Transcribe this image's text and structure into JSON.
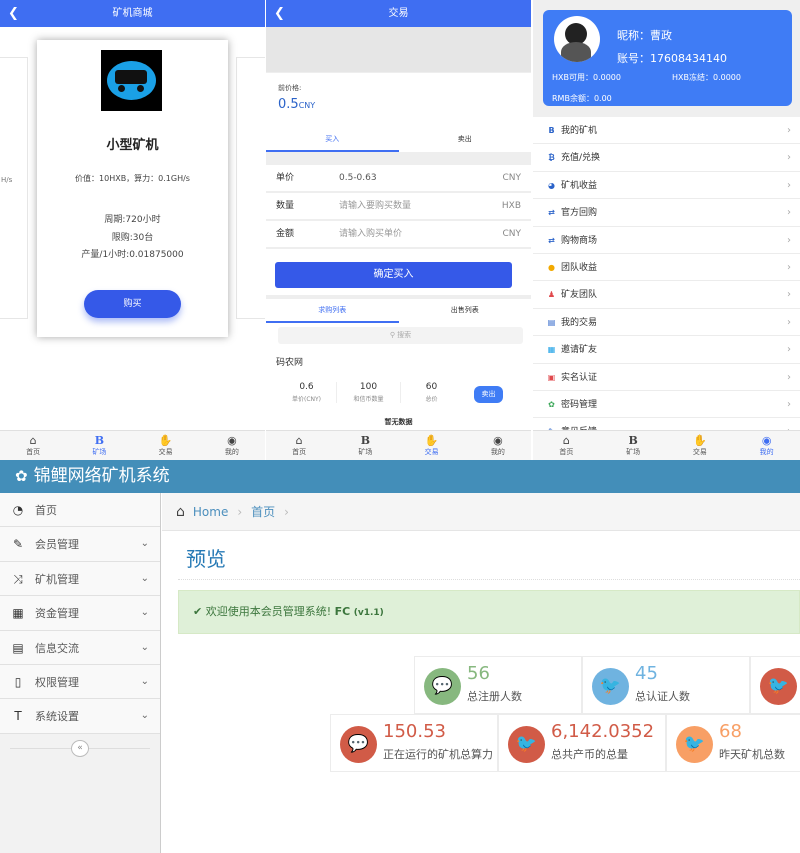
{
  "mining_mall": {
    "header_title": "矿机商城",
    "edge_text": "H/s",
    "product": {
      "name": "小型矿机",
      "price_line": "价值：10HXB，算力：0.1GH/s",
      "period": "周期:720小时",
      "limit": "限购:30台",
      "output": "产量/1小时:0.01875000",
      "buy_label": "购买"
    }
  },
  "trade": {
    "header_title": "交易",
    "prev_price_label": "前价格:",
    "prev_price_value": "0.5",
    "prev_price_unit": "CNY",
    "tabs": [
      "买入",
      "卖出"
    ],
    "form": [
      {
        "label": "单价",
        "value": "0.5-0.63",
        "unit": "CNY"
      },
      {
        "label": "数量",
        "placeholder": "请输入要购买数量",
        "unit": "HXB"
      },
      {
        "label": "金额",
        "placeholder": "请输入购买单价",
        "unit": "CNY"
      }
    ],
    "confirm_label": "确定买入",
    "list_tabs": [
      "求购列表",
      "出售列表"
    ],
    "search_placeholder": "搜索",
    "shop_name": "码农网",
    "order": {
      "unit_price": "0.6",
      "unit_price_label": "单价(CNY)",
      "quantity": "100",
      "quantity_label": "和信币数量",
      "total": "60",
      "total_label": "总价",
      "sell_label": "卖出"
    },
    "no_data": "暂无数据"
  },
  "profile": {
    "nickname": "昵称：曹政",
    "account": "账号：17608434140",
    "hxb_available": "HXB可用：0.0000",
    "hxb_frozen": "HXB冻结：0.0000",
    "rmb_balance": "RMB余额：0.00",
    "menu": [
      {
        "label": "我的矿机",
        "icon": "B",
        "color": "#2b63c9"
      },
      {
        "label": "充值/兑换",
        "icon": "₿",
        "color": "#2b63c9"
      },
      {
        "label": "矿机收益",
        "icon": "◕",
        "color": "#2b63c9"
      },
      {
        "label": "官方回购",
        "icon": "⇄",
        "color": "#2b63c9"
      },
      {
        "label": "购物商场",
        "icon": "⇄",
        "color": "#2b63c9"
      },
      {
        "label": "团队收益",
        "icon": "●",
        "color": "#f2a900"
      },
      {
        "label": "矿友团队",
        "icon": "♟",
        "color": "#e0484c"
      },
      {
        "label": "我的交易",
        "icon": "▤",
        "color": "#2b63c9"
      },
      {
        "label": "邀请矿友",
        "icon": "▦",
        "color": "#1aa0e6"
      },
      {
        "label": "实名认证",
        "icon": "▣",
        "color": "#e0484c"
      },
      {
        "label": "密码管理",
        "icon": "✿",
        "color": "#3aa657"
      },
      {
        "label": "意见反馈",
        "icon": "✎",
        "color": "#2b63c9"
      }
    ]
  },
  "tabbar": [
    {
      "label": "首页",
      "icon": "⌂"
    },
    {
      "label": "矿场",
      "icon": "B"
    },
    {
      "label": "交易",
      "icon": "✋"
    },
    {
      "label": "我的",
      "icon": "◉"
    }
  ],
  "admin": {
    "brand": "锦鲤网络矿机系统",
    "sidebar": [
      {
        "label": "首页",
        "icon": "◔",
        "expandable": false
      },
      {
        "label": "会员管理",
        "icon": "✎",
        "expandable": true
      },
      {
        "label": "矿机管理",
        "icon": "⤨",
        "expandable": true
      },
      {
        "label": "资金管理",
        "icon": "▦",
        "expandable": true
      },
      {
        "label": "信息交流",
        "icon": "▤",
        "expandable": true
      },
      {
        "label": "权限管理",
        "icon": "▯",
        "expandable": true
      },
      {
        "label": "系统设置",
        "icon": "T",
        "expandable": true
      }
    ],
    "collapse_icon": "«",
    "breadcrumb": [
      "Home",
      "首页"
    ],
    "page_title": "预览",
    "alert_text": "欢迎使用本会员管理系统!",
    "alert_brand": "FC",
    "alert_version": "(v1.1)",
    "stats": [
      {
        "value": "56",
        "label": "总注册人数",
        "color": "#87b87f",
        "icon": "💬"
      },
      {
        "value": "45",
        "label": "总认证人数",
        "color": "#6fb3e0",
        "icon": "🐦"
      },
      {
        "value": "",
        "label": "",
        "color": "#d15b47",
        "icon": "🐦"
      },
      {
        "value": "150.53",
        "label": "正在运行的矿机总算力",
        "color": "#d15b47",
        "icon": "💬"
      },
      {
        "value": "6,142.0352",
        "label": "总共产币的总量",
        "color": "#d15b47",
        "icon": "🐦"
      },
      {
        "value": "68",
        "label": "昨天矿机总数",
        "color": "#f89f65",
        "icon": "🐦"
      }
    ]
  }
}
